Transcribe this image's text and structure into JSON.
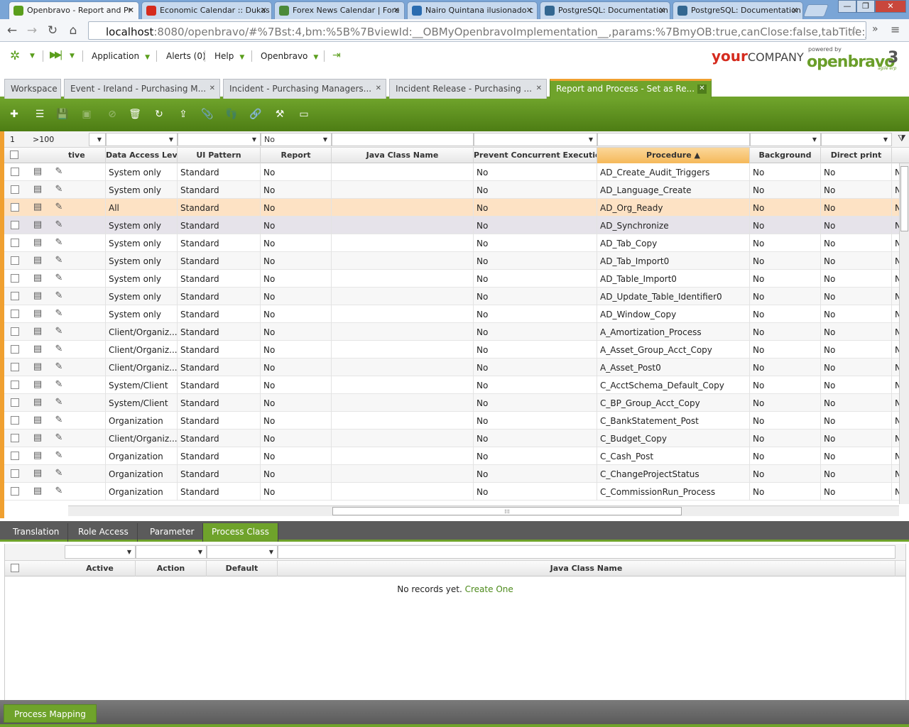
{
  "browser": {
    "tabs": [
      {
        "title": "Openbravo - Report and Pr",
        "icon": "openbravo-favicon",
        "active": true
      },
      {
        "title": "Economic Calendar :: Dukas",
        "icon": "swiss-flag-favicon"
      },
      {
        "title": "Forex News Calendar | Fore",
        "icon": "shield-favicon"
      },
      {
        "title": "Nairo Quintana ilusionado c",
        "icon": "cycling-favicon"
      },
      {
        "title": "PostgreSQL: Documentation",
        "icon": "elephant-favicon"
      },
      {
        "title": "PostgreSQL: Documentation",
        "icon": "elephant-favicon"
      }
    ],
    "close_glyph": "✕",
    "window_controls": [
      "—",
      "❐",
      "✕"
    ],
    "url_host": "localhost",
    "url_rest": ":8080/openbravo/#%7Bst:4,bm:%5B%7BviewId:__OBMyOpenbravoImplementation__,params:%7BmyOB:true,canClose:false,tabTitle:__",
    "more_glyph": "»"
  },
  "app_menu": {
    "items": [
      "Application",
      "Alerts (0)",
      "Help",
      "Openbravo"
    ],
    "logo_your": "your",
    "logo_company": "COMPANY",
    "powered_by": "powered by",
    "openbravo_logo": "openbravo",
    "openbravo_version": "3",
    "agile": "agile erp"
  },
  "mdi_tabs": [
    {
      "label": "Workspace",
      "closable": false
    },
    {
      "label": "Event - Ireland - Purchasing M...",
      "closable": true
    },
    {
      "label": "Incident - Purchasing Managers...",
      "closable": true
    },
    {
      "label": "Incident Release - Purchasing ...",
      "closable": true
    },
    {
      "label": "Report and Process - Set as Re...",
      "closable": true,
      "active": true
    }
  ],
  "toolbar": {
    "buttons": [
      "new-document",
      "new-row",
      "save",
      "save-close",
      "undo",
      "delete",
      "refresh",
      "export",
      "attachment",
      "audit-trail",
      "link",
      "process",
      "toggle-form"
    ]
  },
  "grid": {
    "filter": {
      "count": "1",
      "range": ">100",
      "report_value": "No"
    },
    "columns": [
      "tive",
      "Data Access Level",
      "UI Pattern",
      "Report",
      "Java Class Name",
      "Prevent Concurrent Executions",
      "Procedure ▲",
      "Background",
      "Direct print"
    ],
    "rows": [
      [
        "",
        "System only",
        "Standard",
        "No",
        "",
        "No",
        "AD_Create_Audit_Triggers",
        "No",
        "No",
        "N"
      ],
      [
        "",
        "System only",
        "Standard",
        "No",
        "",
        "No",
        "AD_Language_Create",
        "No",
        "No",
        "N"
      ],
      [
        "",
        "All",
        "Standard",
        "No",
        "",
        "No",
        "AD_Org_Ready",
        "No",
        "No",
        "N"
      ],
      [
        "",
        "System only",
        "Standard",
        "No",
        "",
        "No",
        "AD_Synchronize",
        "No",
        "No",
        "N"
      ],
      [
        "",
        "System only",
        "Standard",
        "No",
        "",
        "No",
        "AD_Tab_Copy",
        "No",
        "No",
        "N"
      ],
      [
        "",
        "System only",
        "Standard",
        "No",
        "",
        "No",
        "AD_Tab_Import0",
        "No",
        "No",
        "N"
      ],
      [
        "",
        "System only",
        "Standard",
        "No",
        "",
        "No",
        "AD_Table_Import0",
        "No",
        "No",
        "N"
      ],
      [
        "",
        "System only",
        "Standard",
        "No",
        "",
        "No",
        "AD_Update_Table_Identifier0",
        "No",
        "No",
        "N"
      ],
      [
        "",
        "System only",
        "Standard",
        "No",
        "",
        "No",
        "AD_Window_Copy",
        "No",
        "No",
        "N"
      ],
      [
        "",
        "Client/Organiz...",
        "Standard",
        "No",
        "",
        "No",
        "A_Amortization_Process",
        "No",
        "No",
        "N"
      ],
      [
        "",
        "Client/Organiz...",
        "Standard",
        "No",
        "",
        "No",
        "A_Asset_Group_Acct_Copy",
        "No",
        "No",
        "N"
      ],
      [
        "",
        "Client/Organiz...",
        "Standard",
        "No",
        "",
        "No",
        "A_Asset_Post0",
        "No",
        "No",
        "N"
      ],
      [
        "",
        "System/Client",
        "Standard",
        "No",
        "",
        "No",
        "C_AcctSchema_Default_Copy",
        "No",
        "No",
        "N"
      ],
      [
        "",
        "System/Client",
        "Standard",
        "No",
        "",
        "No",
        "C_BP_Group_Acct_Copy",
        "No",
        "No",
        "N"
      ],
      [
        "",
        "Organization",
        "Standard",
        "No",
        "",
        "No",
        "C_BankStatement_Post",
        "No",
        "No",
        "N"
      ],
      [
        "",
        "Client/Organiz...",
        "Standard",
        "No",
        "",
        "No",
        "C_Budget_Copy",
        "No",
        "No",
        "N"
      ],
      [
        "",
        "Organization",
        "Standard",
        "No",
        "",
        "No",
        "C_Cash_Post",
        "No",
        "No",
        "N"
      ],
      [
        "",
        "Organization",
        "Standard",
        "No",
        "",
        "No",
        "C_ChangeProjectStatus",
        "No",
        "No",
        "N"
      ],
      [
        "",
        "Organization",
        "Standard",
        "No",
        "",
        "No",
        "C_CommissionRun_Process",
        "No",
        "No",
        "N"
      ]
    ],
    "selected_row": 2,
    "hover_row": 3,
    "hscroll_grip": "⁞⁞⁞"
  },
  "sub_tabs": [
    "Translation",
    "Role Access",
    "Parameter",
    "Process Class"
  ],
  "sub_grid": {
    "columns": [
      "Active",
      "Action",
      "Default",
      "Java Class Name"
    ],
    "empty_text": "No records yet.",
    "create_link": "Create One"
  },
  "bottom_tab": "Process Mapping",
  "colors": {
    "accent_green": "#6fa32b",
    "accent_orange": "#f0a030",
    "selected_row": "#fde2c4"
  }
}
